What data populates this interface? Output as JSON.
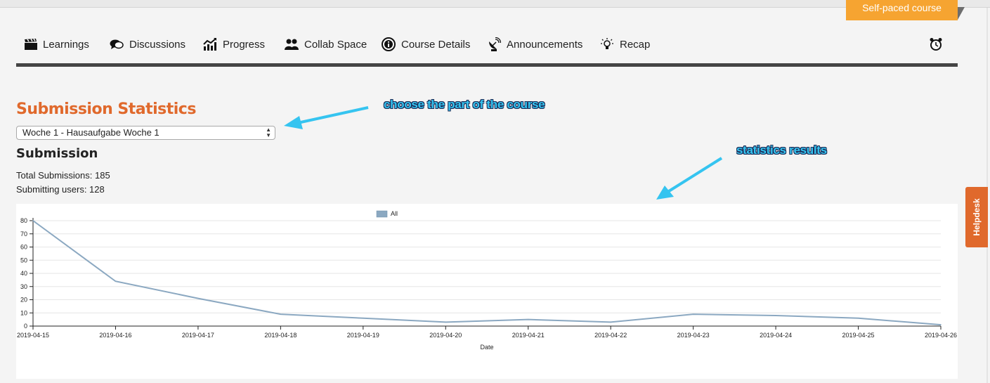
{
  "header": {
    "badge": "Self-paced course"
  },
  "nav": {
    "items": [
      {
        "label": "Learnings",
        "icon": "clapperboard-icon"
      },
      {
        "label": "Discussions",
        "icon": "speech-bubbles-icon"
      },
      {
        "label": "Progress",
        "icon": "progress-chart-icon"
      },
      {
        "label": "Collab Space",
        "icon": "people-icon"
      },
      {
        "label": "Course Details",
        "icon": "info-circle-icon"
      },
      {
        "label": "Announcements",
        "icon": "satellite-dish-icon"
      },
      {
        "label": "Recap",
        "icon": "lightbulb-icon"
      }
    ],
    "right_icon": "alarm-clock-icon"
  },
  "page": {
    "title": "Submission Statistics",
    "select_value": "Woche 1 - Hausaufgabe Woche 1",
    "section_title": "Submission",
    "total_submissions": "Total Submissions: 185",
    "submitting_users": "Submitting users: 128"
  },
  "annotations": {
    "choose": "choose the part of the course",
    "results": "statistics results"
  },
  "helpdesk": "Helpdesk",
  "colors": {
    "accent": "#e0692c",
    "badge": "#f6a431",
    "series": "#8ba8c1",
    "annotation": "#35c4f0"
  },
  "chart_data": {
    "type": "line",
    "x": [
      "2019-04-15",
      "2019-04-16",
      "2019-04-17",
      "2019-04-18",
      "2019-04-19",
      "2019-04-20",
      "2019-04-21",
      "2019-04-22",
      "2019-04-23",
      "2019-04-24",
      "2019-04-25",
      "2019-04-26"
    ],
    "series": [
      {
        "name": "All",
        "values": [
          80,
          34,
          21,
          9,
          6,
          3,
          5,
          3,
          9,
          8,
          6,
          1
        ]
      }
    ],
    "xlabel": "Date",
    "ylabel": "",
    "ylim": [
      0,
      80
    ],
    "yticks": [
      0,
      10,
      20,
      30,
      40,
      50,
      60,
      70,
      80
    ],
    "grid": true,
    "legend": "top-center"
  }
}
